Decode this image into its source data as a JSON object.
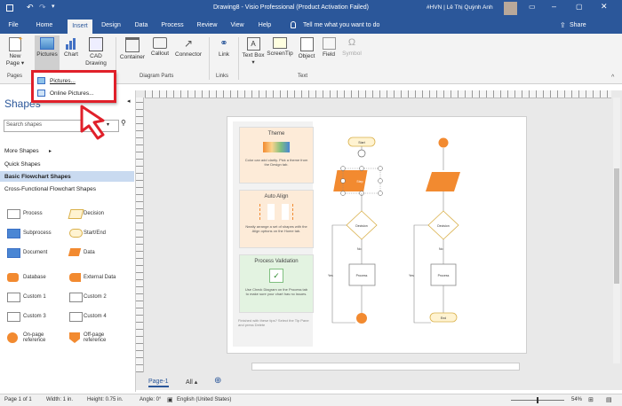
{
  "titlebar": {
    "doc_title": "Drawing8 - Visio Professional (Product Activation Failed)",
    "user": "#HVN | Lê Thị Quỳnh Anh",
    "share": "Share"
  },
  "tabs": [
    "File",
    "Home",
    "Insert",
    "Design",
    "Data",
    "Process",
    "Review",
    "View",
    "Help"
  ],
  "tell_me": "Tell me what you want to do",
  "ribbon": {
    "new_page": "New Page ▾",
    "pictures": "Pictures",
    "chart": "Chart",
    "cad_drawing": "CAD Drawing",
    "container": "Container",
    "callout": "Callout",
    "connector": "Connector",
    "link": "Link",
    "text_box": "Text Box ▾",
    "screentip": "ScreenTip",
    "object": "Object",
    "field": "Field",
    "symbol": "Symbol",
    "groups": {
      "pages": "Pages",
      "diagram_parts": "Diagram Parts",
      "links": "Links",
      "text": "Text"
    }
  },
  "menu": {
    "pictures": "Pictures...",
    "online_pictures": "Online Pictures..."
  },
  "shapes_panel": {
    "title": "Shapes",
    "search_placeholder": "Search shapes",
    "categories": [
      "More Shapes",
      "Quick Shapes",
      "Basic Flowchart Shapes",
      "Cross-Functional Flowchart Shapes"
    ],
    "stencil": [
      [
        "Process",
        "Decision"
      ],
      [
        "Subprocess",
        "Start/End"
      ],
      [
        "Document",
        "Data"
      ],
      [
        "Database",
        "External Data"
      ],
      [
        "Custom 1",
        "Custom 2"
      ],
      [
        "Custom 3",
        "Custom 4"
      ],
      [
        "On-page reference",
        "Off-page reference"
      ]
    ]
  },
  "canvas": {
    "cards": [
      {
        "title": "Theme",
        "text": "Color can add clarity. Pick a theme from the Design tab."
      },
      {
        "title": "Auto Align",
        "text": "Neatly arrange a set of shapes with the Align options on the Home tab."
      },
      {
        "title": "Process Validation",
        "text": "Use Check Diagram on the Process tab to make sure your chart has no issues."
      }
    ],
    "finished_note": "Finished with these tips? Select the Tip Pane and press Delete",
    "flow_labels": {
      "start": "Start",
      "step": "Step",
      "decision": "Decision",
      "process": "Process",
      "end": "End",
      "yes": "Yes",
      "no": "No"
    }
  },
  "page_tabs": {
    "page1": "Page-1",
    "all": "All ▴"
  },
  "status": {
    "page": "Page 1 of 1",
    "width": "Width: 1 in.",
    "height": "Height: 0.75 in.",
    "angle": "Angle: 0°",
    "language": "English (United States)",
    "zoom": "54%"
  },
  "colors": {
    "brand": "#2b579a",
    "accent_orange": "#f28a30",
    "highlight_red": "#e0202a",
    "card_orange": "#fdebd8",
    "card_green": "#e3f3e1"
  }
}
